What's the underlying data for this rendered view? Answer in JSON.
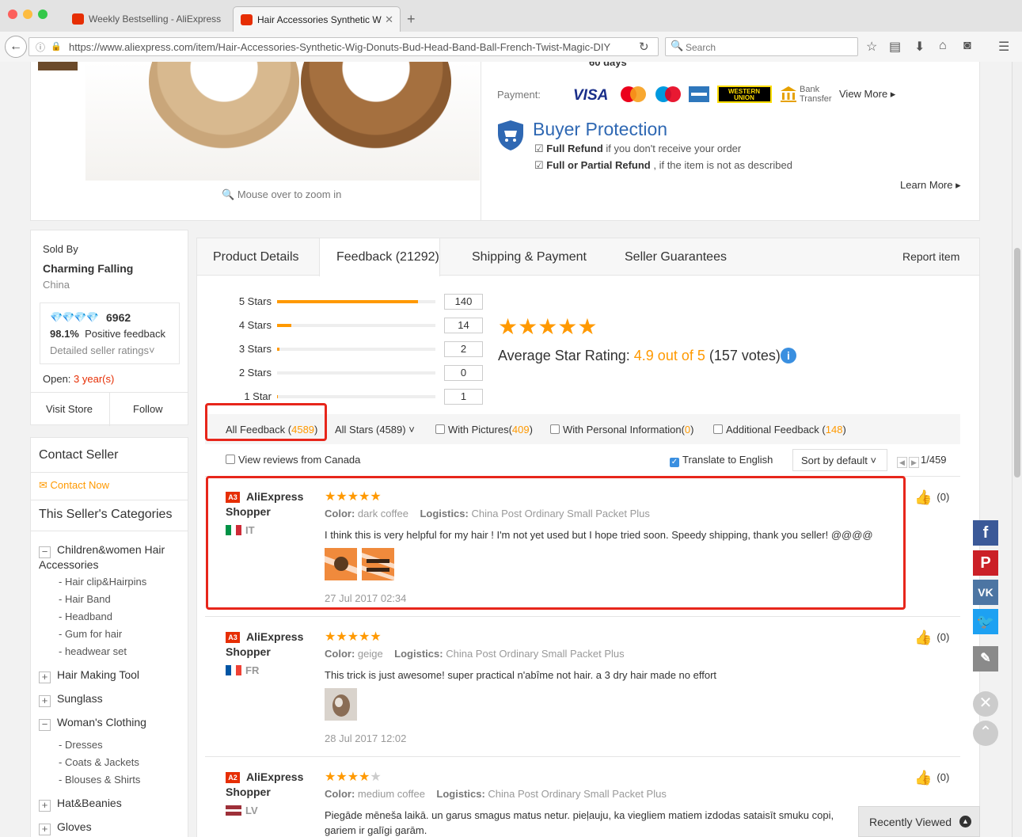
{
  "browser": {
    "tabs": [
      {
        "title": "Weekly Bestselling - AliExpress"
      },
      {
        "title": "Hair Accessories Synthetic W"
      }
    ],
    "url": "https://www.aliexpress.com/item/Hair-Accessories-Synthetic-Wig-Donuts-Bud-Head-Band-Ball-French-Twist-Magic-DIY",
    "search_placeholder": "Search"
  },
  "product": {
    "days_fragment": "60 days",
    "zoom_hint": "Mouse over to zoom in",
    "payment_label": "Payment:",
    "payment_methods": [
      "VISA",
      "MasterCard",
      "Maestro",
      "AmEx",
      "WESTERN UNION",
      "Bank Transfer"
    ],
    "view_more": "View More",
    "buyer_protection": {
      "title": "Buyer Protection",
      "line1_bold": "Full Refund",
      "line1_rest": " if you don't receive your order",
      "line2_bold": "Full or Partial Refund",
      "line2_rest": " , if the item is not as described",
      "learn_more": "Learn More"
    }
  },
  "seller": {
    "sold_by": "Sold By",
    "name": "Charming Falling",
    "country": "China",
    "diamonds": "💎💎💎💎",
    "score": "6962",
    "positive_pct": "98.1%",
    "positive_label": "Positive feedback",
    "detailed": "Detailed seller ratings",
    "open_label": "Open:",
    "open_value": "3 year(s)",
    "visit_store": "Visit Store",
    "follow": "Follow"
  },
  "sidebar": {
    "contact_title": "Contact Seller",
    "contact_now": "Contact Now",
    "categories_title": "This Seller's Categories",
    "categories": [
      {
        "label": "Children&women Hair Accessories",
        "expanded": true,
        "subs": [
          "- Hair clip&Hairpins",
          "- Hair Band",
          "- Headband",
          "- Gum for hair",
          "- headwear set"
        ]
      },
      {
        "label": "Hair Making Tool",
        "expanded": false
      },
      {
        "label": "Sunglass",
        "expanded": false
      },
      {
        "label": "Woman's Clothing",
        "expanded": true,
        "subs": [
          "- Dresses",
          "- Coats & Jackets",
          "- Blouses & Shirts"
        ]
      },
      {
        "label": "Hat&Beanies",
        "expanded": false
      },
      {
        "label": "Gloves",
        "expanded": false
      }
    ]
  },
  "product_tabs": {
    "details": "Product Details",
    "feedback": "Feedback (21292)",
    "shipping": "Shipping & Payment",
    "guarantees": "Seller Guarantees",
    "report": "Report item"
  },
  "ratings": {
    "rows": [
      {
        "label": "5 Stars",
        "count": "140",
        "fraction": 0.89
      },
      {
        "label": "4 Stars",
        "count": "14",
        "fraction": 0.09
      },
      {
        "label": "3 Stars",
        "count": "2",
        "fraction": 0.013
      },
      {
        "label": "2 Stars",
        "count": "0",
        "fraction": 0
      },
      {
        "label": "1 Star",
        "count": "1",
        "fraction": 0.006
      }
    ],
    "avg_label": "Average Star Rating:",
    "avg_value": "4.9 out of 5",
    "votes": "(157 votes)"
  },
  "filters": {
    "all_feedback": "All Feedback",
    "all_feedback_count": "4589",
    "all_stars": "All Stars (4589)",
    "with_pictures": "With Pictures",
    "with_pictures_count": "409",
    "with_personal": "With Personal Information",
    "with_personal_count": "0",
    "additional": "Additional Feedback",
    "additional_count": "148",
    "view_canada": "View reviews from Canada",
    "translate": "Translate to English",
    "sort": "Sort by default",
    "page": "1/459"
  },
  "reviews": [
    {
      "badge": "A3",
      "name": "AliExpress Shopper",
      "country": "IT",
      "stars": 5,
      "color_label": "Color:",
      "color": "dark coffee",
      "logistics_label": "Logistics:",
      "logistics": "China Post Ordinary Small Packet Plus",
      "text": "I think this is very helpful for my hair ! I'm not yet used but I hope tried soon. Speedy shipping, thank you seller! @@@@",
      "images": 2,
      "date": "27 Jul 2017 02:34",
      "helpful": "(0)"
    },
    {
      "badge": "A3",
      "name": "AliExpress Shopper",
      "country": "FR",
      "stars": 5,
      "color_label": "Color:",
      "color": "geige",
      "logistics_label": "Logistics:",
      "logistics": "China Post Ordinary Small Packet Plus",
      "text": "This trick is just awesome! super practical n'abîme not hair. a 3 dry hair made no effort",
      "images": 1,
      "date": "28 Jul 2017 12:02",
      "helpful": "(0)"
    },
    {
      "badge": "A2",
      "name": "AliExpress Shopper",
      "country": "LV",
      "stars": 4,
      "color_label": "Color:",
      "color": "medium coffee",
      "logistics_label": "Logistics:",
      "logistics": "China Post Ordinary Small Packet Plus",
      "text": "Piegāde mēneša laikā. un garus smagus matus netur. pieļauju, ka viegliem matiem izdodas sataisīt smuku copi, gariem ir galīgi garām.",
      "images": 0,
      "date": "",
      "helpful": "(0)"
    }
  ],
  "floating": {
    "recently_viewed": "Recently Viewed"
  },
  "colors": {
    "accent_orange": "#ff9900",
    "brand_red": "#e62e04",
    "highlight_red": "#e7261b",
    "link_blue": "#2f68b3"
  }
}
